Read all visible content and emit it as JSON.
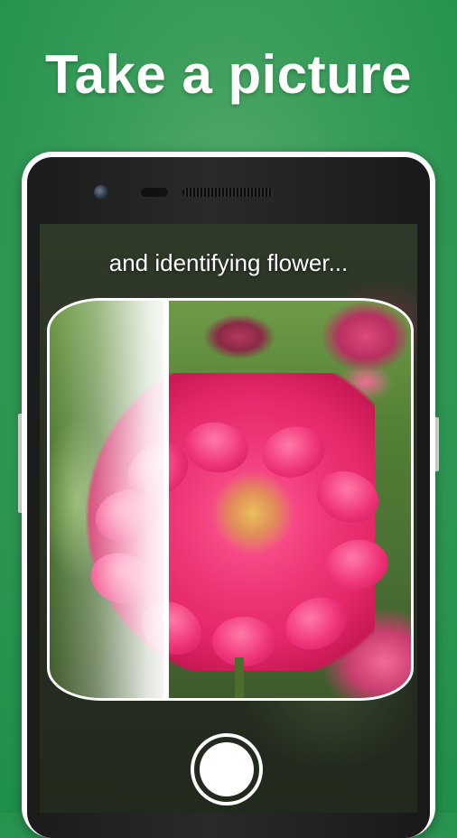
{
  "headline": "Take a picture",
  "screen": {
    "status_text": "and identifying flower..."
  },
  "icons": {
    "front_camera": "front-camera-icon",
    "earpiece": "speaker-grille-icon",
    "shutter": "shutter-button-icon"
  },
  "colors": {
    "background_green": "#2f9a55",
    "flower_pink": "#f03a7b",
    "text": "#ffffff"
  }
}
